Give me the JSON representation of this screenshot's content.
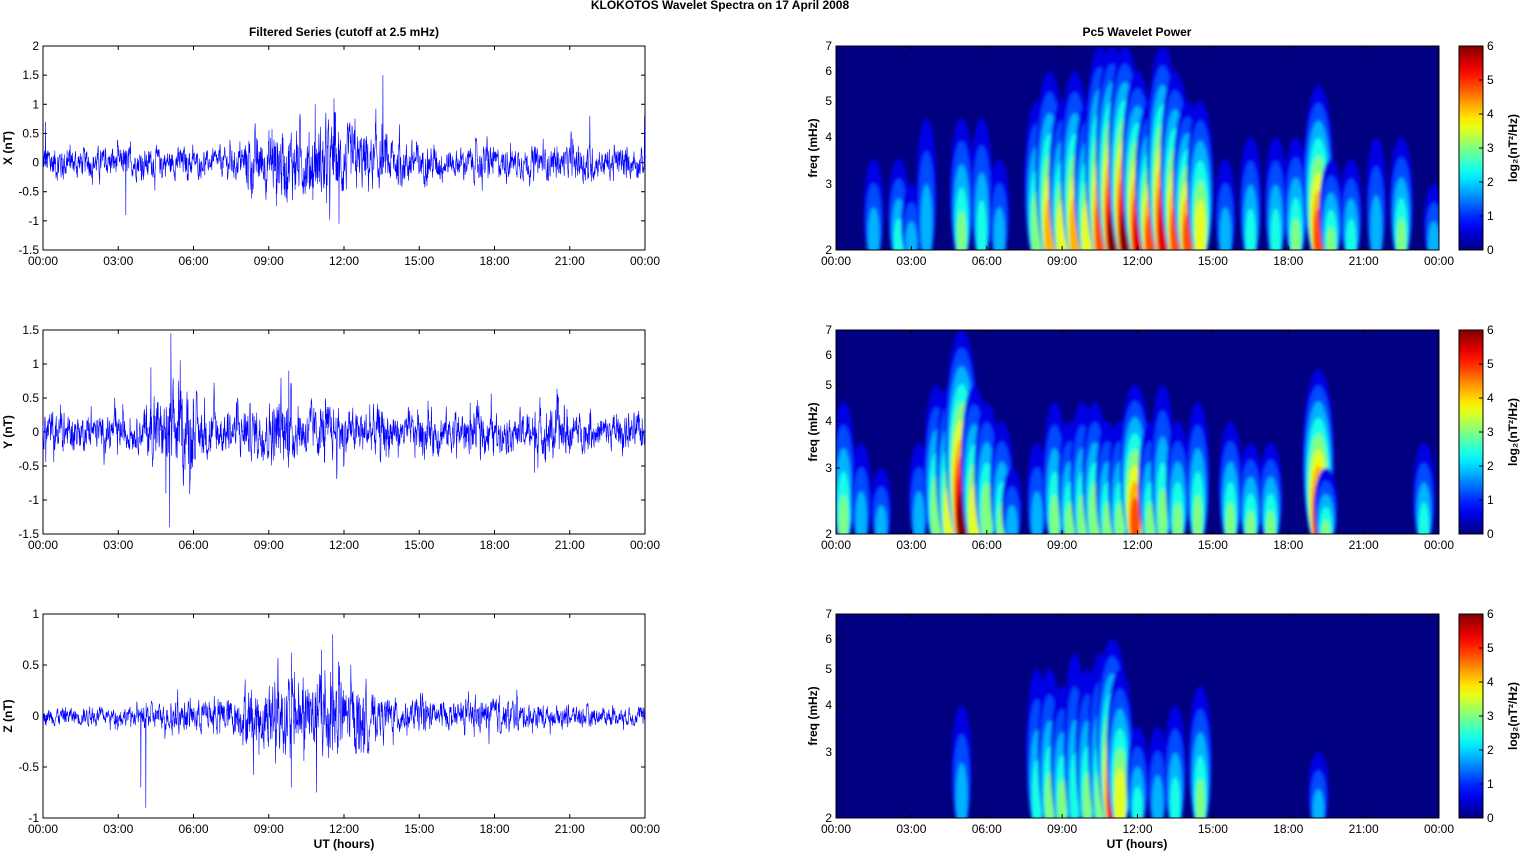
{
  "title": "KLOKOTOS Wavelet Spectra on 17 April     2008",
  "left_title": "Filtered Series (cutoff at 2.5 mHz)",
  "right_title": "Pc5 Wavelet Power",
  "xlabel": "UT (hours)",
  "time_ticks": [
    "00:00",
    "03:00",
    "06:00",
    "09:00",
    "12:00",
    "15:00",
    "18:00",
    "21:00",
    "00:00"
  ],
  "freq_label": "freq (mHz)",
  "freq_ticks": [
    "2",
    "3",
    "4",
    "5",
    "6",
    "7"
  ],
  "colorbar": {
    "label": "log₂(nT²/Hz)",
    "ticks": [
      "0",
      "1",
      "2",
      "3",
      "4",
      "5",
      "6"
    ],
    "range": [
      0,
      6
    ],
    "colormap": "jet"
  },
  "chart_data": [
    {
      "type": "line",
      "component": "X",
      "ylabel": "X (nT)",
      "ylim": [
        -1.5,
        2
      ],
      "yticks": [
        "-1.5",
        "-1",
        "-0.5",
        "0",
        "0.5",
        "1",
        "1.5",
        "2"
      ],
      "ytick_values": [
        -1.5,
        -1,
        -0.5,
        0,
        0.5,
        1,
        1.5,
        2
      ],
      "color": "#0000ff",
      "xlim_hours": [
        0,
        24
      ],
      "hourly_amplitude": [
        0.25,
        0.2,
        0.2,
        0.2,
        0.2,
        0.2,
        0.15,
        0.2,
        0.4,
        0.5,
        0.45,
        0.5,
        0.45,
        0.35,
        0.3,
        0.25,
        0.2,
        0.25,
        0.2,
        0.2,
        0.2,
        0.25,
        0.2,
        0.2
      ],
      "spikes": [
        {
          "t": 13.55,
          "v": 1.5
        },
        {
          "t": 11.6,
          "v": 1.1
        },
        {
          "t": 10.85,
          "v": 1.0
        },
        {
          "t": 11.8,
          "v": -1.05
        },
        {
          "t": 3.3,
          "v": -0.9
        },
        {
          "t": 21.8,
          "v": 0.8
        },
        {
          "t": 0.1,
          "v": 0.7
        },
        {
          "t": 23.98,
          "v": 0.8
        },
        {
          "t": 9.3,
          "v": -0.75
        }
      ]
    },
    {
      "type": "line",
      "component": "Y",
      "ylabel": "Y (nT)",
      "ylim": [
        -1.5,
        1.5
      ],
      "yticks": [
        "-1.5",
        "-1",
        "-0.5",
        "0",
        "0.5",
        "1",
        "1.5"
      ],
      "ytick_values": [
        -1.5,
        -1,
        -0.5,
        0,
        0.5,
        1,
        1.5
      ],
      "color": "#0000ff",
      "xlim_hours": [
        0,
        24
      ],
      "hourly_amplitude": [
        0.25,
        0.2,
        0.2,
        0.2,
        0.35,
        0.5,
        0.3,
        0.25,
        0.3,
        0.4,
        0.3,
        0.3,
        0.25,
        0.3,
        0.2,
        0.25,
        0.25,
        0.25,
        0.2,
        0.25,
        0.3,
        0.2,
        0.2,
        0.2
      ],
      "spikes": [
        {
          "t": 5.1,
          "v": 1.45
        },
        {
          "t": 5.05,
          "v": -1.4
        },
        {
          "t": 4.3,
          "v": 0.95
        },
        {
          "t": 9.8,
          "v": 0.9
        },
        {
          "t": 19.6,
          "v": -0.6
        },
        {
          "t": 4.9,
          "v": -0.9
        }
      ]
    },
    {
      "type": "line",
      "component": "Z",
      "ylabel": "Z (nT)",
      "ylim": [
        -1,
        1
      ],
      "yticks": [
        "-1",
        "-0.5",
        "0",
        "0.5",
        "1"
      ],
      "ytick_values": [
        -1,
        -0.5,
        0,
        0.5,
        1
      ],
      "color": "#0000ff",
      "xlim_hours": [
        0,
        24
      ],
      "hourly_amplitude": [
        0.07,
        0.07,
        0.07,
        0.07,
        0.1,
        0.12,
        0.12,
        0.15,
        0.25,
        0.3,
        0.3,
        0.35,
        0.25,
        0.15,
        0.12,
        0.12,
        0.1,
        0.12,
        0.12,
        0.1,
        0.08,
        0.08,
        0.07,
        0.07
      ],
      "spikes": [
        {
          "t": 11.55,
          "v": 0.8
        },
        {
          "t": 4.1,
          "v": -0.9
        },
        {
          "t": 3.9,
          "v": -0.7
        },
        {
          "t": 10.9,
          "v": -0.75
        },
        {
          "t": 11.1,
          "v": 0.65
        },
        {
          "t": 9.9,
          "v": -0.7
        }
      ]
    },
    {
      "type": "heatmap",
      "component": "X",
      "ylim_mHz": [
        2,
        7
      ],
      "xlim_hours": [
        0,
        24
      ],
      "zlim": [
        0,
        6
      ],
      "hotspots": [
        [
          1.5,
          2,
          3.5
        ],
        [
          2.5,
          2.5,
          3.5
        ],
        [
          3.0,
          2,
          3
        ],
        [
          3.6,
          2,
          4.5
        ],
        [
          5.0,
          3,
          4.5
        ],
        [
          5.8,
          2.5,
          4.5
        ],
        [
          6.5,
          2,
          3.5
        ],
        [
          8.0,
          3.5,
          5
        ],
        [
          8.5,
          4.5,
          6
        ],
        [
          9.0,
          4,
          5
        ],
        [
          9.5,
          4.5,
          6
        ],
        [
          10.0,
          4,
          5
        ],
        [
          10.5,
          5,
          7
        ],
        [
          11.0,
          6,
          7
        ],
        [
          11.5,
          6,
          7
        ],
        [
          12.0,
          5.5,
          6
        ],
        [
          12.5,
          5,
          5
        ],
        [
          13.0,
          5.5,
          7
        ],
        [
          13.5,
          5,
          6
        ],
        [
          14.0,
          5,
          5
        ],
        [
          14.5,
          4,
          5
        ],
        [
          15.5,
          2,
          3.5
        ],
        [
          16.5,
          2.5,
          4
        ],
        [
          17.5,
          2.5,
          4
        ],
        [
          18.3,
          3,
          4
        ],
        [
          19.2,
          5,
          5.5
        ],
        [
          19.7,
          3,
          3.5
        ],
        [
          20.5,
          2.5,
          3.5
        ],
        [
          21.5,
          2,
          4
        ],
        [
          22.5,
          3,
          4
        ],
        [
          23.8,
          2,
          3
        ]
      ]
    },
    {
      "type": "heatmap",
      "component": "Y",
      "ylim_mHz": [
        2,
        7
      ],
      "xlim_hours": [
        0,
        24
      ],
      "zlim": [
        0,
        6
      ],
      "hotspots": [
        [
          0.3,
          3,
          4.5
        ],
        [
          1.0,
          2,
          3.5
        ],
        [
          1.8,
          2,
          3
        ],
        [
          3.3,
          2,
          3.5
        ],
        [
          4.0,
          3.5,
          5
        ],
        [
          4.5,
          4,
          5
        ],
        [
          5.0,
          6,
          7
        ],
        [
          5.5,
          4,
          5
        ],
        [
          6.0,
          3.5,
          4.5
        ],
        [
          6.6,
          3,
          4
        ],
        [
          7.0,
          2,
          3
        ],
        [
          8.0,
          2,
          3.5
        ],
        [
          8.7,
          3,
          4.5
        ],
        [
          9.3,
          3,
          4
        ],
        [
          9.8,
          3,
          4.5
        ],
        [
          10.3,
          3.5,
          4.5
        ],
        [
          10.8,
          3,
          4
        ],
        [
          11.3,
          3,
          4
        ],
        [
          11.9,
          5,
          5
        ],
        [
          12.5,
          3,
          4
        ],
        [
          13.0,
          3,
          5
        ],
        [
          13.6,
          3,
          4
        ],
        [
          14.4,
          3,
          4.5
        ],
        [
          15.7,
          3,
          4
        ],
        [
          16.5,
          3,
          3.5
        ],
        [
          17.3,
          3,
          3.5
        ],
        [
          19.2,
          5.5,
          5.5
        ],
        [
          19.5,
          3,
          3
        ],
        [
          23.4,
          2.5,
          3.5
        ]
      ]
    },
    {
      "type": "heatmap",
      "component": "Z",
      "ylim_mHz": [
        2,
        7
      ],
      "xlim_hours": [
        0,
        24
      ],
      "zlim": [
        0,
        6
      ],
      "hotspots": [
        [
          5.0,
          2,
          4
        ],
        [
          8.0,
          2.5,
          5
        ],
        [
          8.5,
          3,
          5
        ],
        [
          9.0,
          3,
          4.5
        ],
        [
          9.5,
          2.5,
          5.5
        ],
        [
          10.0,
          3,
          5
        ],
        [
          10.5,
          3,
          5.5
        ],
        [
          11.0,
          5.5,
          6
        ],
        [
          11.3,
          4,
          5
        ],
        [
          12.0,
          2.5,
          3.5
        ],
        [
          12.8,
          2,
          3.5
        ],
        [
          13.5,
          2.5,
          4
        ],
        [
          14.5,
          3,
          4.5
        ],
        [
          19.2,
          2,
          3
        ]
      ]
    }
  ]
}
